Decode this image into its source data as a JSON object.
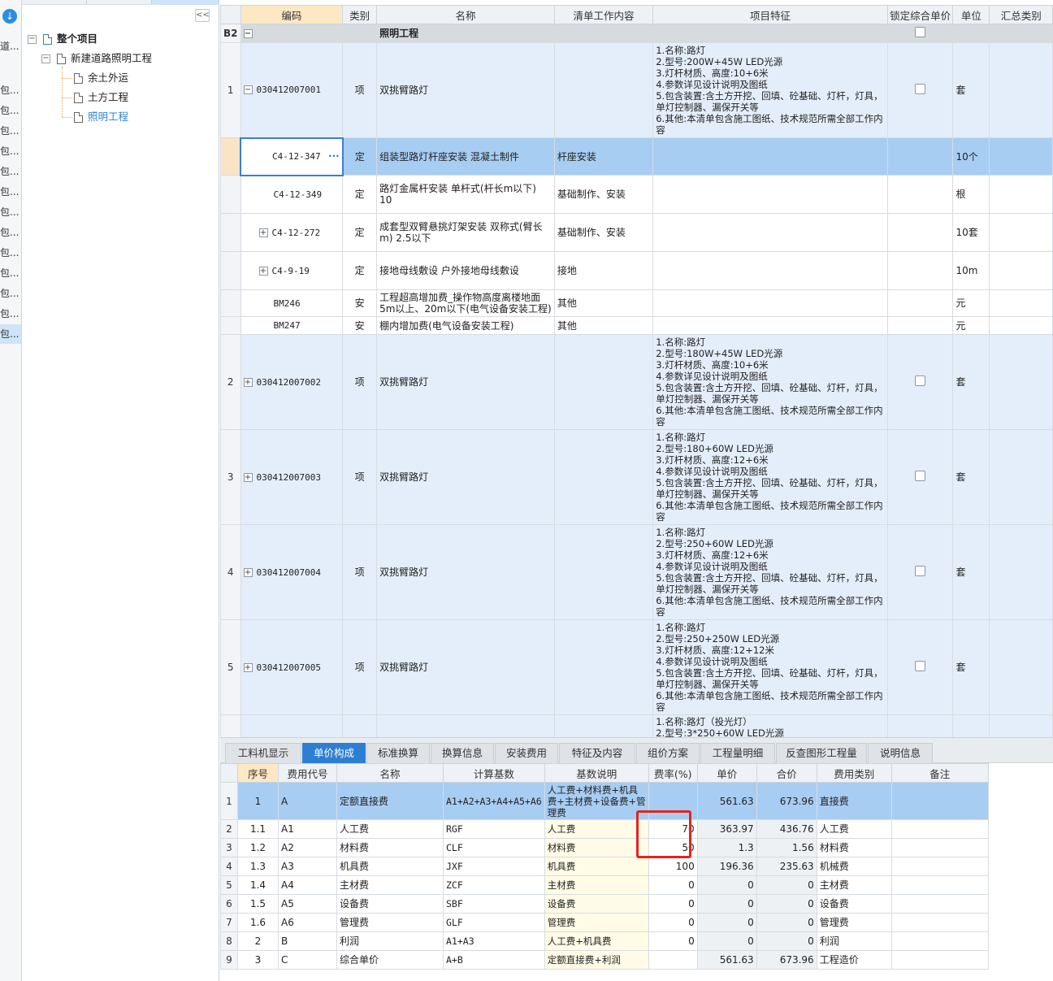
{
  "sidebar_strip": {
    "top_label": "道...",
    "items": [
      "包...",
      "包...",
      "包...",
      "包...",
      "包...",
      "包...",
      "包...",
      "包...",
      "包...",
      "包...",
      "包...",
      "包...",
      "包..."
    ]
  },
  "tree": {
    "root": "整个项目",
    "project": "新建道路照明工程",
    "children": [
      "余土外运",
      "土方工程",
      "照明工程"
    ],
    "collapse_glyph": "<<"
  },
  "grid": {
    "headers": [
      "编码",
      "类别",
      "名称",
      "清单工作内容",
      "项目特征",
      "锁定综合单价",
      "单位",
      "汇总类别"
    ],
    "group": {
      "row": "B2",
      "name": "照明工程"
    },
    "rows": [
      {
        "rn": "1",
        "code": "030412007001",
        "type": "项",
        "name": "双挑臂路灯",
        "work": "",
        "feat": [
          "1.名称:路灯",
          "2.型号:200W+45W LED光源",
          "3.灯杆材质、高度:10+6米",
          "4.参数详见设计说明及图纸",
          "5.包含装置:含土方开挖、回填、砼基础、灯杆，灯具，单灯控制器、漏保开关等",
          "6.其他:本清单包含施工图纸、技术规范所需全部工作内容"
        ],
        "unit": "套"
      },
      {
        "rn": "",
        "code": "C4-12-347",
        "type": "定",
        "name": "组装型路灯杆座安装 混凝土制件",
        "work": "杆座安装",
        "unit": "10个"
      },
      {
        "rn": "",
        "code": "C4-12-349",
        "type": "定",
        "name": "路灯金属杆安装 单杆式(杆长m以下) 10",
        "work": "基础制作、安装",
        "unit": "根"
      },
      {
        "rn": "",
        "code": "C4-12-272",
        "type": "定",
        "name": "成套型双臂悬挑灯架安装 双称式(臂长m) 2.5以下",
        "work": "基础制作、安装",
        "unit": "10套"
      },
      {
        "rn": "",
        "code": "C4-9-19",
        "type": "定",
        "name": "接地母线敷设 户外接地母线敷设",
        "work": "接地",
        "unit": "10m"
      },
      {
        "rn": "",
        "code": "BM246",
        "type": "安",
        "name": "工程超高增加费_操作物高度离楼地面5m以上、20m以下(电气设备安装工程)",
        "work": "其他",
        "unit": "元"
      },
      {
        "rn": "",
        "code": "BM247",
        "type": "安",
        "name": "棚内增加费(电气设备安装工程)",
        "work": "其他",
        "unit": "元"
      },
      {
        "rn": "2",
        "code": "030412007002",
        "type": "项",
        "name": "双挑臂路灯",
        "feat": [
          "1.名称:路灯",
          "2.型号:180W+45W LED光源",
          "3.灯杆材质、高度:10+6米",
          "4.参数详见设计说明及图纸",
          "5.包含装置:含土方开挖、回填、砼基础、灯杆，灯具，单灯控制器、漏保开关等",
          "6.其他:本清单包含施工图纸、技术规范所需全部工作内容"
        ],
        "unit": "套"
      },
      {
        "rn": "3",
        "code": "030412007003",
        "type": "项",
        "name": "双挑臂路灯",
        "feat": [
          "1.名称:路灯",
          "2.型号:180+60W LED光源",
          "3.灯杆材质、高度:12+6米",
          "4.参数详见设计说明及图纸",
          "5.包含装置:含土方开挖、回填、砼基础、灯杆，灯具，单灯控制器、漏保开关等",
          "6.其他:本清单包含施工图纸、技术规范所需全部工作内容"
        ],
        "unit": "套"
      },
      {
        "rn": "4",
        "code": "030412007004",
        "type": "项",
        "name": "双挑臂路灯",
        "feat": [
          "1.名称:路灯",
          "2.型号:250+60W LED光源",
          "3.灯杆材质、高度:12+6米",
          "4.参数详见设计说明及图纸",
          "5.包含装置:含土方开挖、回填、砼基础、灯杆，灯具，单灯控制器、漏保开关等",
          "6.其他:本清单包含施工图纸、技术规范所需全部工作内容"
        ],
        "unit": "套"
      },
      {
        "rn": "5",
        "code": "030412007005",
        "type": "项",
        "name": "双挑臂路灯",
        "feat": [
          "1.名称:路灯",
          "2.型号:250+250W LED光源",
          "3.灯杆材质、高度:12+12米",
          "4.参数详见设计说明及图纸",
          "5.包含装置:含土方开挖、回填、砼基础、灯杆，灯具，单灯控制器、漏保开关等",
          "6.其他:本清单包含施工图纸、技术规范所需全部工作内容"
        ],
        "unit": "套"
      }
    ],
    "partial_feat": [
      "1.名称:路灯（投光灯）",
      "2.型号:3*250+60W LED光源"
    ],
    "more_glyph": "···"
  },
  "tabs": [
    "工料机显示",
    "单价构成",
    "标准换算",
    "换算信息",
    "安装费用",
    "特征及内容",
    "组价方案",
    "工程量明细",
    "反查图形工程量",
    "说明信息"
  ],
  "active_tab": "单价构成",
  "bottom": {
    "headers": [
      "序号",
      "费用代号",
      "名称",
      "计算基数",
      "基数说明",
      "费率(%)",
      "单价",
      "合价",
      "费用类别",
      "备注"
    ],
    "rows": [
      {
        "rn": "1",
        "seq": "1",
        "code": "A",
        "name": "定额直接费",
        "base": "A1+A2+A3+A4+A5+A6",
        "desc": "人工费+材料费+机具费+主材费+设备费+管理费",
        "rate": "",
        "price": "561.63",
        "total": "673.96",
        "cat": "直接费",
        "note": ""
      },
      {
        "rn": "2",
        "seq": "1.1",
        "code": "A1",
        "name": "人工费",
        "base": "RGF",
        "desc": "人工费",
        "rate": "70",
        "price": "363.97",
        "total": "436.76",
        "cat": "人工费",
        "note": ""
      },
      {
        "rn": "3",
        "seq": "1.2",
        "code": "A2",
        "name": "材料费",
        "base": "CLF",
        "desc": "材料费",
        "rate": "50",
        "price": "1.3",
        "total": "1.56",
        "cat": "材料费",
        "note": ""
      },
      {
        "rn": "4",
        "seq": "1.3",
        "code": "A3",
        "name": "机具费",
        "base": "JXF",
        "desc": "机具费",
        "rate": "100",
        "price": "196.36",
        "total": "235.63",
        "cat": "机械费",
        "note": ""
      },
      {
        "rn": "5",
        "seq": "1.4",
        "code": "A4",
        "name": "主材费",
        "base": "ZCF",
        "desc": "主材费",
        "rate": "0",
        "price": "0",
        "total": "0",
        "cat": "主材费",
        "note": ""
      },
      {
        "rn": "6",
        "seq": "1.5",
        "code": "A5",
        "name": "设备费",
        "base": "SBF",
        "desc": "设备费",
        "rate": "0",
        "price": "0",
        "total": "0",
        "cat": "设备费",
        "note": ""
      },
      {
        "rn": "7",
        "seq": "1.6",
        "code": "A6",
        "name": "管理费",
        "base": "GLF",
        "desc": "管理费",
        "rate": "0",
        "price": "0",
        "total": "0",
        "cat": "管理费",
        "note": ""
      },
      {
        "rn": "8",
        "seq": "2",
        "code": "B",
        "name": "利润",
        "base": "A1+A3",
        "desc": "人工费+机具费",
        "rate": "0",
        "price": "0",
        "total": "0",
        "cat": "利润",
        "note": ""
      },
      {
        "rn": "9",
        "seq": "3",
        "code": "C",
        "name": "综合单价",
        "base": "A+B",
        "desc": "定额直接费+利润",
        "rate": "",
        "price": "561.63",
        "total": "673.96",
        "cat": "工程造价",
        "note": ""
      }
    ]
  },
  "colors": {
    "accent": "#2d7fd3",
    "selected_row": "#a7cdf3",
    "item_row": "#e4eefb",
    "annotation": "#e4241c"
  }
}
